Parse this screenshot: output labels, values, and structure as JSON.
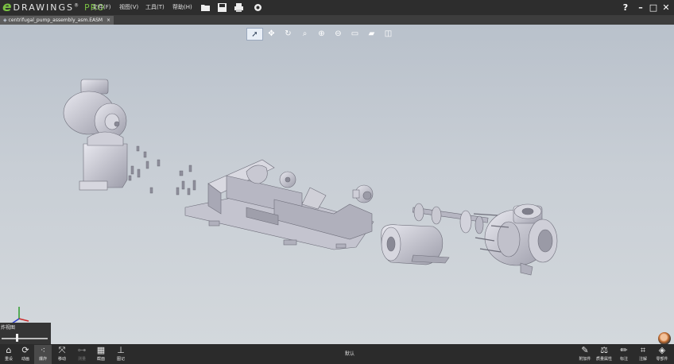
{
  "app": {
    "logo_e": "e",
    "logo_word": "DRAWINGS",
    "logo_reg": "®",
    "logo_pro": "PRO"
  },
  "menu": {
    "file": "文件(F)",
    "view": "视图(V)",
    "tools": "工具(T)",
    "help": "帮助(H)"
  },
  "toolbar_icons": [
    "open-icon",
    "save-icon",
    "print-icon",
    "settings-icon"
  ],
  "window": {
    "help": "?",
    "minimize": "–",
    "maximize": "□",
    "close": "✕"
  },
  "document": {
    "tab_name": "centrifugal_pump_assembly_asm.EASM",
    "tab_close": "×"
  },
  "view_tools": [
    "select-icon",
    "pan-icon",
    "rotate-icon",
    "zoom-area-icon",
    "zoom-fit-icon",
    "zoom-icon",
    "display-icon",
    "view-orientation-icon",
    "section-cube-icon"
  ],
  "explode": {
    "label": "炸视图",
    "value": 0.33
  },
  "bottom_left": [
    {
      "label": "重设",
      "icon": "home-icon"
    },
    {
      "label": "动画",
      "icon": "animate-icon"
    },
    {
      "label": "爆炸",
      "icon": "explode-icon"
    },
    {
      "label": "移动",
      "icon": "move-icon"
    },
    {
      "label": "测量",
      "icon": "measure-icon"
    },
    {
      "label": "截面",
      "icon": "section-icon"
    },
    {
      "label": "图记",
      "icon": "stamp-icon"
    }
  ],
  "configuration": "默认",
  "bottom_right": [
    {
      "label": "附加件",
      "icon": "paperclip-icon"
    },
    {
      "label": "质量属性",
      "icon": "scale-icon"
    },
    {
      "label": "标注",
      "icon": "pencil-icon"
    },
    {
      "label": "注解",
      "icon": "note-icon"
    },
    {
      "label": "零部件",
      "icon": "parts-icon"
    }
  ],
  "colors": {
    "titlebar": "#2d2d2d",
    "accent_green": "#7ac143",
    "viewport_top": "#b9c1cb",
    "viewport_bottom": "#d3d8dc",
    "part_gray": "#c8c8d2"
  }
}
